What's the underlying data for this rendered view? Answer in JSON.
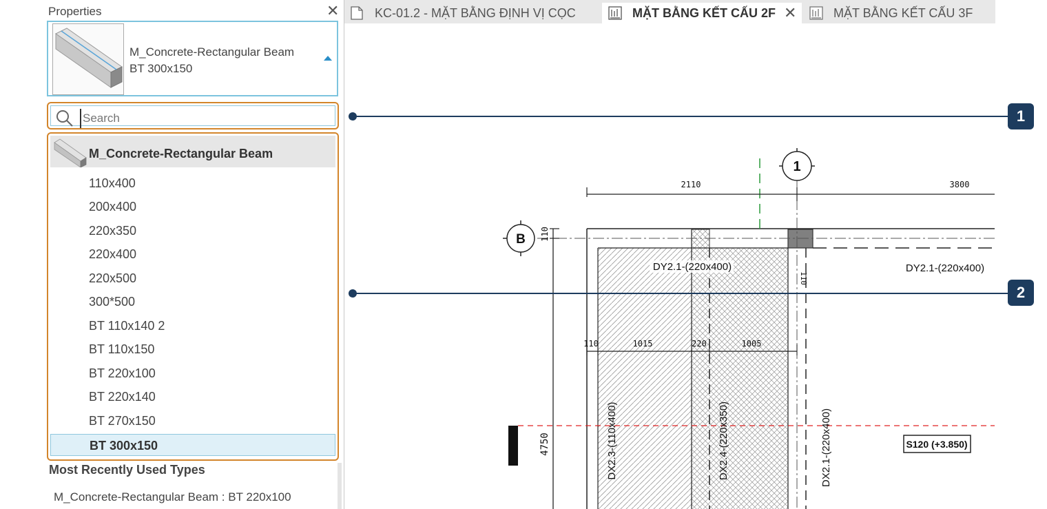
{
  "properties": {
    "title": "Properties",
    "type_selector": {
      "family": "M_Concrete-Rectangular Beam",
      "type": "BT 300x150"
    },
    "search": {
      "placeholder": "Search",
      "value": ""
    },
    "family": {
      "name": "M_Concrete-Rectangular Beam"
    },
    "types": [
      {
        "label": "110x400",
        "selected": false
      },
      {
        "label": "200x400",
        "selected": false
      },
      {
        "label": "220x350",
        "selected": false
      },
      {
        "label": "220x400",
        "selected": false
      },
      {
        "label": "220x500",
        "selected": false
      },
      {
        "label": "300*500",
        "selected": false
      },
      {
        "label": "BT 110x140 2",
        "selected": false
      },
      {
        "label": "BT 110x150",
        "selected": false
      },
      {
        "label": "BT 220x100",
        "selected": false
      },
      {
        "label": "BT 220x140",
        "selected": false
      },
      {
        "label": "BT 270x150",
        "selected": false
      },
      {
        "label": "BT 300x150",
        "selected": true
      }
    ],
    "recent": {
      "title": "Most Recently Used Types",
      "items": [
        "M_Concrete-Rectangular Beam : BT 220x100"
      ]
    }
  },
  "tabs": [
    {
      "label": "KC-01.2 - MẶT BẰNG ĐỊNH VỊ CỌC",
      "active": false
    },
    {
      "label": "MẶT BẰNG KẾT CẤU 2F",
      "active": true
    },
    {
      "label": "MẶT BẰNG KẾT CẤU 3F",
      "active": false
    }
  ],
  "drawing": {
    "grid_1": "1",
    "grid_b": "B",
    "dim_top_left": "2110",
    "dim_top_right": "3800",
    "dim_110_left": "110",
    "dim_110_right": "110",
    "dims_row": [
      "110",
      "1015",
      "220",
      "1005"
    ],
    "dim_4750": "4750",
    "beam_dy_1": "DY2.1-(220x400)",
    "beam_dy_2": "DY2.1-(220x400)",
    "beam_dx_23": "DX2.3-(110x400)",
    "beam_dx_24": "DX2.4-(220x350)",
    "beam_dx_21": "DX2.1-(220x400)",
    "slab_tag": "S120 (+3.850)"
  },
  "callouts": [
    "1",
    "2"
  ],
  "colors": {
    "highlight_orange": "#d3852b",
    "callout_navy": "#1d3c5e",
    "selected_blue": "#dff0f8",
    "level_red": "#e02020",
    "grid_green": "#2a9a3a"
  }
}
